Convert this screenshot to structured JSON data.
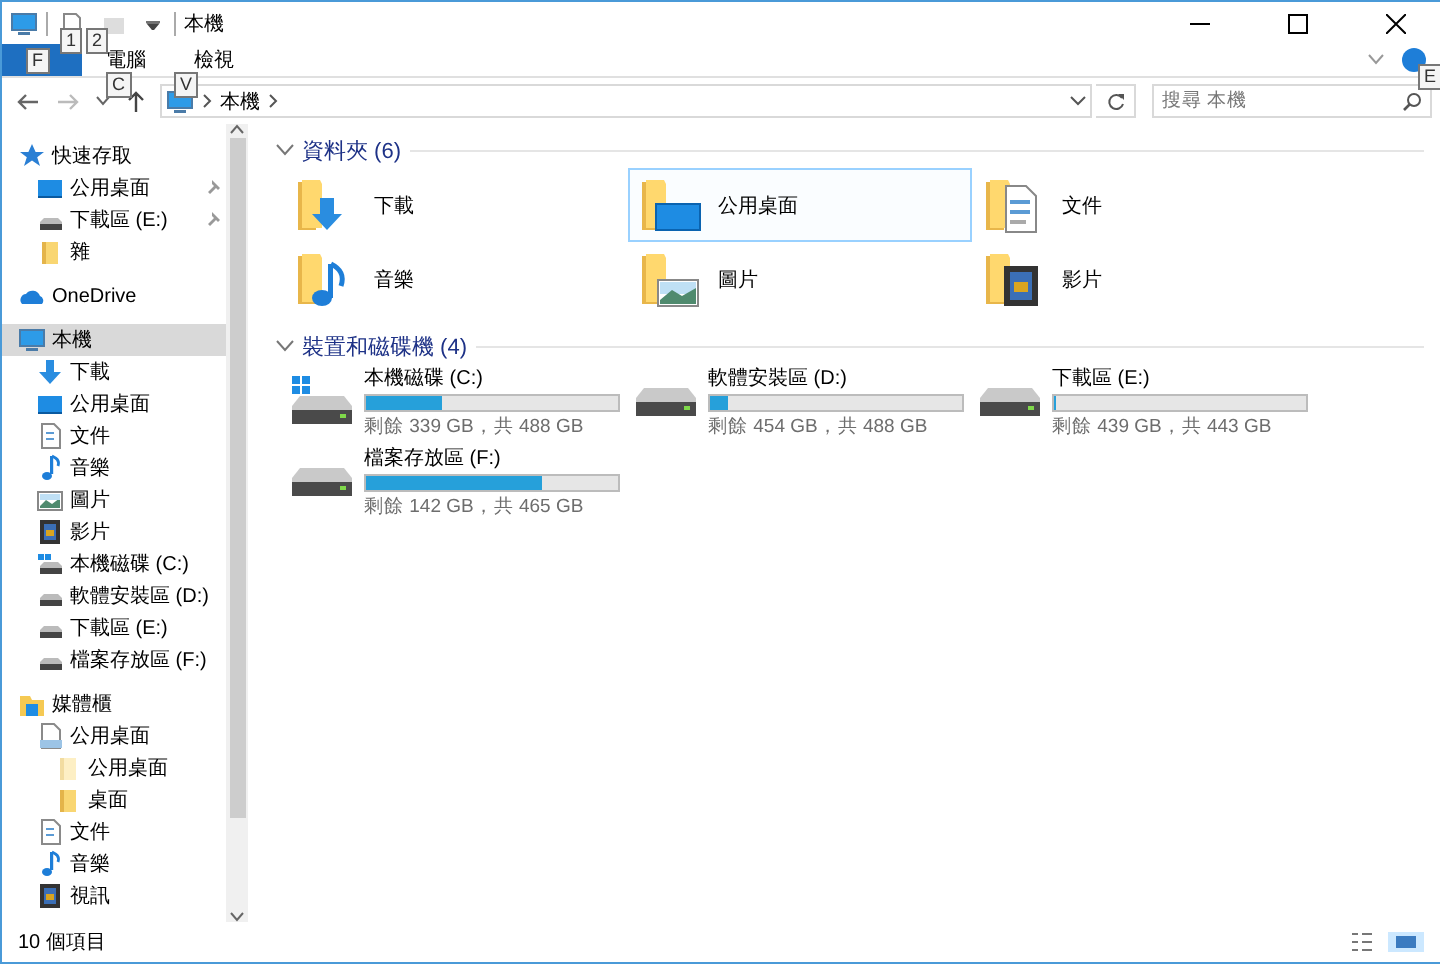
{
  "window": {
    "title": "本機"
  },
  "keytips": [
    "1",
    "2",
    "F",
    "C",
    "V",
    "E"
  ],
  "ribbon": {
    "tabs": [
      {
        "label": "電腦",
        "selected": false
      },
      {
        "label": "檢視",
        "selected": false
      }
    ]
  },
  "address": {
    "path": [
      "本機"
    ]
  },
  "search": {
    "placeholder": "搜尋 本機"
  },
  "sidebar": {
    "items": [
      {
        "label": "快速存取",
        "kind": "star",
        "selected": false,
        "children": [
          {
            "label": "公用桌面",
            "kind": "desktop",
            "selected": false,
            "pinned": true
          },
          {
            "label": "下載區 (E:)",
            "kind": "drive",
            "selected": false,
            "pinned": true
          },
          {
            "label": "雜",
            "kind": "folder",
            "selected": false,
            "pinned": false
          }
        ]
      },
      {
        "label": "OneDrive",
        "kind": "cloud",
        "selected": false
      },
      {
        "label": "本機",
        "kind": "computer",
        "selected": true,
        "children": [
          {
            "label": "下載",
            "kind": "download",
            "selected": false
          },
          {
            "label": "公用桌面",
            "kind": "desktop",
            "selected": false
          },
          {
            "label": "文件",
            "kind": "document",
            "selected": false
          },
          {
            "label": "音樂",
            "kind": "music",
            "selected": false
          },
          {
            "label": "圖片",
            "kind": "picture",
            "selected": false
          },
          {
            "label": "影片",
            "kind": "video",
            "selected": false
          },
          {
            "label": "本機磁碟 (C:)",
            "kind": "windrive",
            "selected": false
          },
          {
            "label": "軟體安裝區 (D:)",
            "kind": "drive",
            "selected": false
          },
          {
            "label": "下載區 (E:)",
            "kind": "drive",
            "selected": false
          },
          {
            "label": "檔案存放區 (F:)",
            "kind": "drive",
            "selected": false
          }
        ]
      },
      {
        "label": "媒體櫃",
        "kind": "library",
        "selected": false,
        "children": [
          {
            "label": "公用桌面",
            "kind": "libdoc",
            "selected": false,
            "children": [
              {
                "label": "公用桌面",
                "kind": "folderlight",
                "selected": false
              },
              {
                "label": "桌面",
                "kind": "folder",
                "selected": false
              }
            ]
          },
          {
            "label": "文件",
            "kind": "document",
            "selected": false
          },
          {
            "label": "音樂",
            "kind": "music",
            "selected": false
          },
          {
            "label": "視訊",
            "kind": "video",
            "selected": false
          }
        ]
      }
    ]
  },
  "folders": {
    "title": "資料夾 (6)",
    "items": [
      {
        "label": "下載",
        "kind": "download",
        "selected": false
      },
      {
        "label": "公用桌面",
        "kind": "desktop",
        "selected": true
      },
      {
        "label": "文件",
        "kind": "document",
        "selected": false
      },
      {
        "label": "音樂",
        "kind": "music",
        "selected": false
      },
      {
        "label": "圖片",
        "kind": "picture",
        "selected": false
      },
      {
        "label": "影片",
        "kind": "video",
        "selected": false
      }
    ]
  },
  "drives": {
    "title": "裝置和磁碟機 (4)",
    "items": [
      {
        "label": "本機磁碟 (C:)",
        "kind": "windrive",
        "level": 0.305,
        "detail": "剩餘 339 GB，共 488 GB"
      },
      {
        "label": "軟體安裝區 (D:)",
        "kind": "drive",
        "level": 0.07,
        "detail": "剩餘 454 GB，共 488 GB"
      },
      {
        "label": "下載區 (E:)",
        "kind": "drive",
        "level": 0.01,
        "detail": "剩餘 439 GB，共 443 GB"
      },
      {
        "label": "檔案存放區 (F:)",
        "kind": "drive",
        "level": 0.695,
        "detail": "剩餘 142 GB，共 465 GB"
      }
    ]
  },
  "status_bar": {
    "text": "10 個項目"
  }
}
